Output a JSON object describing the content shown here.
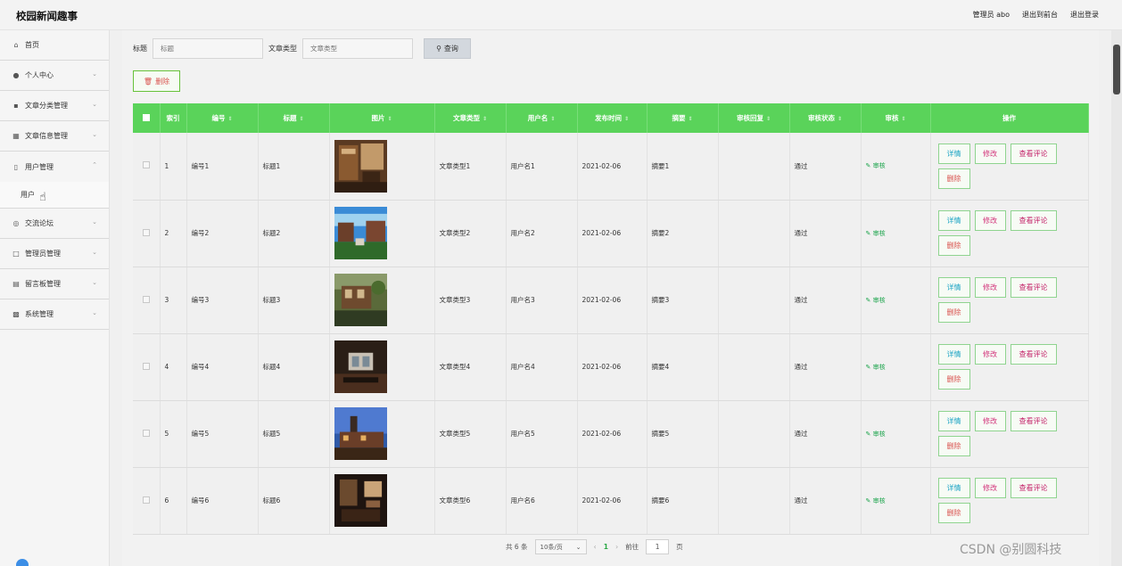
{
  "header": {
    "title": "校园新闻趣事",
    "admin_label": "管理员 abo",
    "back_front": "退出到前台",
    "logout": "退出登录"
  },
  "sidebar": {
    "items": [
      {
        "label": "首页",
        "icon": "home-icon"
      },
      {
        "label": "个人中心",
        "icon": "user-icon"
      },
      {
        "label": "文章分类管理",
        "icon": "tag-icon"
      },
      {
        "label": "文章信息管理",
        "icon": "document-icon"
      },
      {
        "label": "用户管理",
        "icon": "clipboard-icon"
      },
      {
        "label": "交流论坛",
        "icon": "globe-icon"
      },
      {
        "label": "管理员管理",
        "icon": "crop-icon"
      },
      {
        "label": "留言板管理",
        "icon": "board-icon"
      },
      {
        "label": "系统管理",
        "icon": "chart-icon"
      }
    ],
    "sub_user": "用户"
  },
  "search": {
    "title_label": "标题",
    "title_placeholder": "标题",
    "type_label": "文章类型",
    "type_placeholder": "文章类型",
    "query_label": "查询"
  },
  "actions": {
    "delete_label": "删除"
  },
  "table": {
    "columns": [
      "",
      "索引",
      "编号",
      "标题",
      "图片",
      "文章类型",
      "用户名",
      "发布时间",
      "摘要",
      "审核回复",
      "审核状态",
      "审核",
      "操作"
    ],
    "audit_label": "审核",
    "op_labels": {
      "detail": "详情",
      "edit": "修改",
      "comment": "查看评论",
      "delete": "删除"
    },
    "rows": [
      {
        "index": "1",
        "code": "编号1",
        "title": "标题1",
        "type": "文章类型1",
        "user": "用户名1",
        "date": "2021-02-06",
        "summary": "摘要1",
        "reply": "",
        "status": "通过"
      },
      {
        "index": "2",
        "code": "编号2",
        "title": "标题2",
        "type": "文章类型2",
        "user": "用户名2",
        "date": "2021-02-06",
        "summary": "摘要2",
        "reply": "",
        "status": "通过"
      },
      {
        "index": "3",
        "code": "编号3",
        "title": "标题3",
        "type": "文章类型3",
        "user": "用户名3",
        "date": "2021-02-06",
        "summary": "摘要3",
        "reply": "",
        "status": "通过"
      },
      {
        "index": "4",
        "code": "编号4",
        "title": "标题4",
        "type": "文章类型4",
        "user": "用户名4",
        "date": "2021-02-06",
        "summary": "摘要4",
        "reply": "",
        "status": "通过"
      },
      {
        "index": "5",
        "code": "编号5",
        "title": "标题5",
        "type": "文章类型5",
        "user": "用户名5",
        "date": "2021-02-06",
        "summary": "摘要5",
        "reply": "",
        "status": "通过"
      },
      {
        "index": "6",
        "code": "编号6",
        "title": "标题6",
        "type": "文章类型6",
        "user": "用户名6",
        "date": "2021-02-06",
        "summary": "摘要6",
        "reply": "",
        "status": "通过"
      }
    ]
  },
  "pagination": {
    "total": "共 6 条",
    "page_size": "10条/页",
    "current": "1",
    "goto_label": "前往",
    "goto_value": "1",
    "page_suffix": "页"
  },
  "watermark": "CSDN @别圆科技",
  "colors": {
    "header_green": "#5ad35a",
    "accent_green": "#2aa845"
  }
}
